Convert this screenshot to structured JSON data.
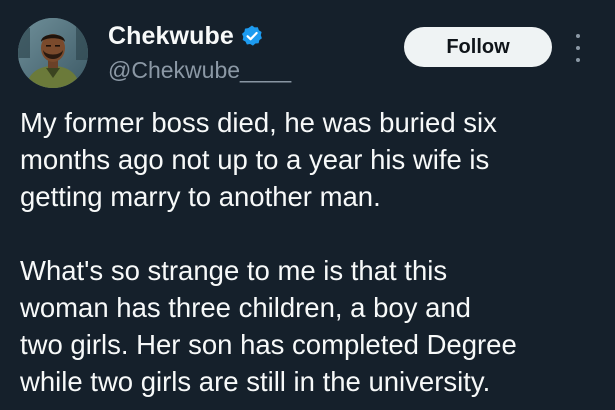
{
  "user": {
    "display_name": "Chekwube",
    "handle": "@Chekwube____",
    "verified": true
  },
  "actions": {
    "follow_label": "Follow"
  },
  "icons": {
    "verified": "verified-badge-icon",
    "more": "more-options-icon"
  },
  "colors": {
    "background": "#15202b",
    "text": "#f7f9f9",
    "secondary_text": "#8b98a5",
    "verified_blue": "#1d9bf0",
    "follow_button_bg": "#eff3f4"
  },
  "tweet": {
    "paragraphs": [
      {
        "lines": [
          "My former boss died, he was buried six",
          "months ago not up to a year his wife is",
          "getting marry to another man."
        ]
      },
      {
        "lines": [
          "What's so strange to me is that this",
          "woman has three children, a boy and",
          "two girls. Her son has completed Degree",
          "while two girls are still in the university."
        ]
      }
    ]
  }
}
